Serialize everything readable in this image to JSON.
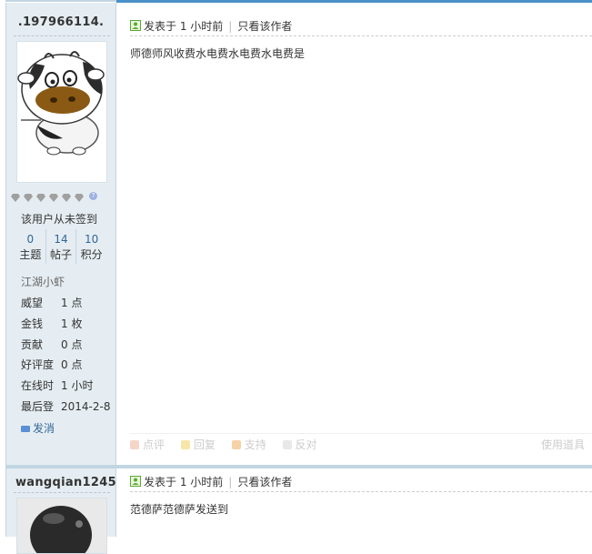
{
  "posts": [
    {
      "username": ".197966114.",
      "signin_text": "该用户从未签到",
      "stats": [
        {
          "value": "0",
          "label": "主题"
        },
        {
          "value": "14",
          "label": "帖子"
        },
        {
          "value": "10",
          "label": "积分"
        }
      ],
      "rank": "江湖小虾",
      "info": [
        {
          "key": "威望",
          "value": "1 点"
        },
        {
          "key": "金钱",
          "value": "1 枚"
        },
        {
          "key": "贡献",
          "value": "0 点"
        },
        {
          "key": "好评度",
          "value": "0 点"
        },
        {
          "key": "在线时",
          "value": "1 小时"
        },
        {
          "key": "最后登",
          "value": "2014-2-8"
        }
      ],
      "pm_label": "发消",
      "posted": "发表于 1 小时前",
      "only_author": "只看该作者",
      "content": "师德师风收费水电费水电费水电费是",
      "actions": {
        "rate": "点评",
        "reply": "回复",
        "support": "支持",
        "oppose": "反对",
        "tools": "使用道具"
      }
    },
    {
      "username": "wangqian1245",
      "posted": "发表于 1 小时前",
      "only_author": "只看该作者",
      "content": "范德萨范德萨发送到"
    }
  ],
  "colors": {
    "sidebar_bg": "#e5edf2",
    "border": "#c2d5e3",
    "link_blue": "#336699"
  }
}
